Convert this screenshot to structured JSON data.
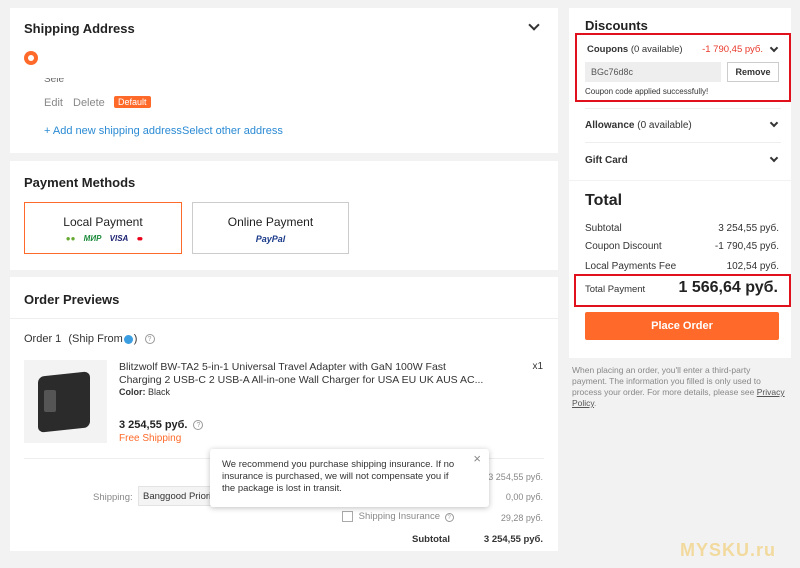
{
  "shipping": {
    "title": "Shipping Address",
    "partial_text": "Sele",
    "edit": "Edit",
    "delete": "Delete",
    "default_badge": "Default",
    "add_new": "+ Add new shipping address",
    "select_other": "Select other address"
  },
  "payment": {
    "title": "Payment Methods",
    "local": "Local Payment",
    "online": "Online Payment",
    "local_logos": [
      "●●",
      "МИР",
      "VISA",
      "●●"
    ],
    "online_logo": "PayPal"
  },
  "order": {
    "title": "Order Previews",
    "order_label": "Order 1",
    "ship_from": "(Ship From",
    "ship_from_end": ")",
    "product_name_1": "Blitzwolf BW-TA2 5-in-1 Universal Travel Adapter with GaN 100W Fast",
    "product_name_2": "Charging 2 USB-C 2 USB-A All-in-one Wall Charger for USA EU UK AUS AC...",
    "color_label": "Color:",
    "color_value": "Black",
    "qty": "x1",
    "price": "3 254,55 руб.",
    "free_shipping": "Free Shipping",
    "item_subtotal": "3 254,55 руб.",
    "shipping_label": "Shipping:",
    "shipping_method": "Banggood Priorit",
    "shipping_cost": "0,00 руб.",
    "insurance_label": "Shipping Insurance",
    "insurance_cost": "29,28 руб.",
    "subtotal_label": "Subtotal",
    "subtotal_value": "3 254,55 руб.",
    "tooltip": "We recommend you purchase shipping insurance. If no insurance is purchased, we will not compensate you if the package is lost in transit."
  },
  "discounts": {
    "title": "Discounts",
    "coupons_label": "Coupons",
    "coupons_count": "(0 available)",
    "coupons_amount": "-1 790,45 руб.",
    "coupon_code": "BGc76d8c",
    "remove": "Remove",
    "success": "Coupon code applied successfully!",
    "allowance_label": "Allowance",
    "allowance_count": "(0 available)",
    "gift_card": "Gift Card"
  },
  "total": {
    "title": "Total",
    "subtotal_label": "Subtotal",
    "subtotal_value": "3 254,55 руб.",
    "coupon_label": "Coupon Discount",
    "coupon_value": "-1 790,45 руб.",
    "fee_label": "Local Payments Fee",
    "fee_value": "102,54 руб.",
    "payment_label": "Total Payment",
    "payment_value": "1 566,64 руб.",
    "place_order": "Place Order",
    "notice": "When placing an order, you'll enter a third-party payment. The information you filled is only used to process your order. For more details, please see",
    "privacy": "Privacy Policy",
    "notice_end": "."
  },
  "watermark": "MYSKU.ru",
  "colors": {
    "accent": "#ff6a2a",
    "highlight": "#e0101c",
    "link": "#2a8ad4"
  }
}
